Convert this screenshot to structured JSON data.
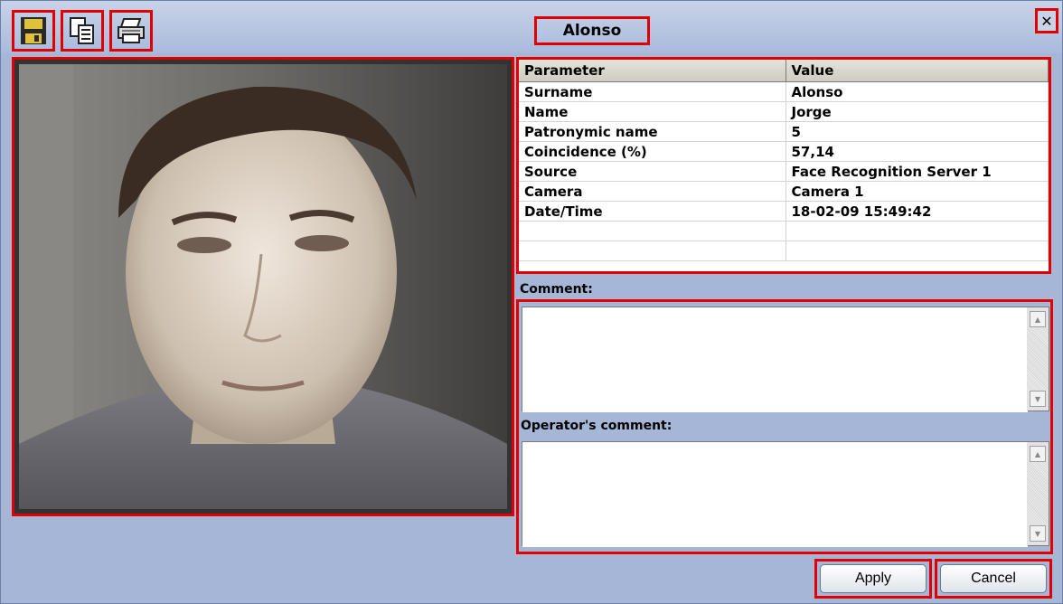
{
  "window": {
    "title": "Alonso"
  },
  "toolbar": {
    "icons": [
      "save-icon",
      "copy-icon",
      "print-icon"
    ]
  },
  "close_glyph": "✕",
  "table": {
    "headers": [
      "Parameter",
      "Value"
    ],
    "rows": [
      [
        "Surname",
        "Alonso"
      ],
      [
        "Name",
        "Jorge"
      ],
      [
        "Patronymic name",
        "5"
      ],
      [
        "Coincidence (%)",
        "57,14"
      ],
      [
        "Source",
        "Face Recognition Server 1"
      ],
      [
        "Camera",
        "Camera 1"
      ],
      [
        "Date/Time",
        "18-02-09 15:49:42"
      ],
      [
        "",
        ""
      ],
      [
        "",
        ""
      ]
    ]
  },
  "comment": {
    "label": "Comment:",
    "value": ""
  },
  "operator_comment": {
    "label": "Operator's comment:",
    "value": ""
  },
  "buttons": {
    "apply": "Apply",
    "cancel": "Cancel"
  },
  "colors": {
    "highlight": "#e00000",
    "window_bg": "#a5b6d6"
  }
}
